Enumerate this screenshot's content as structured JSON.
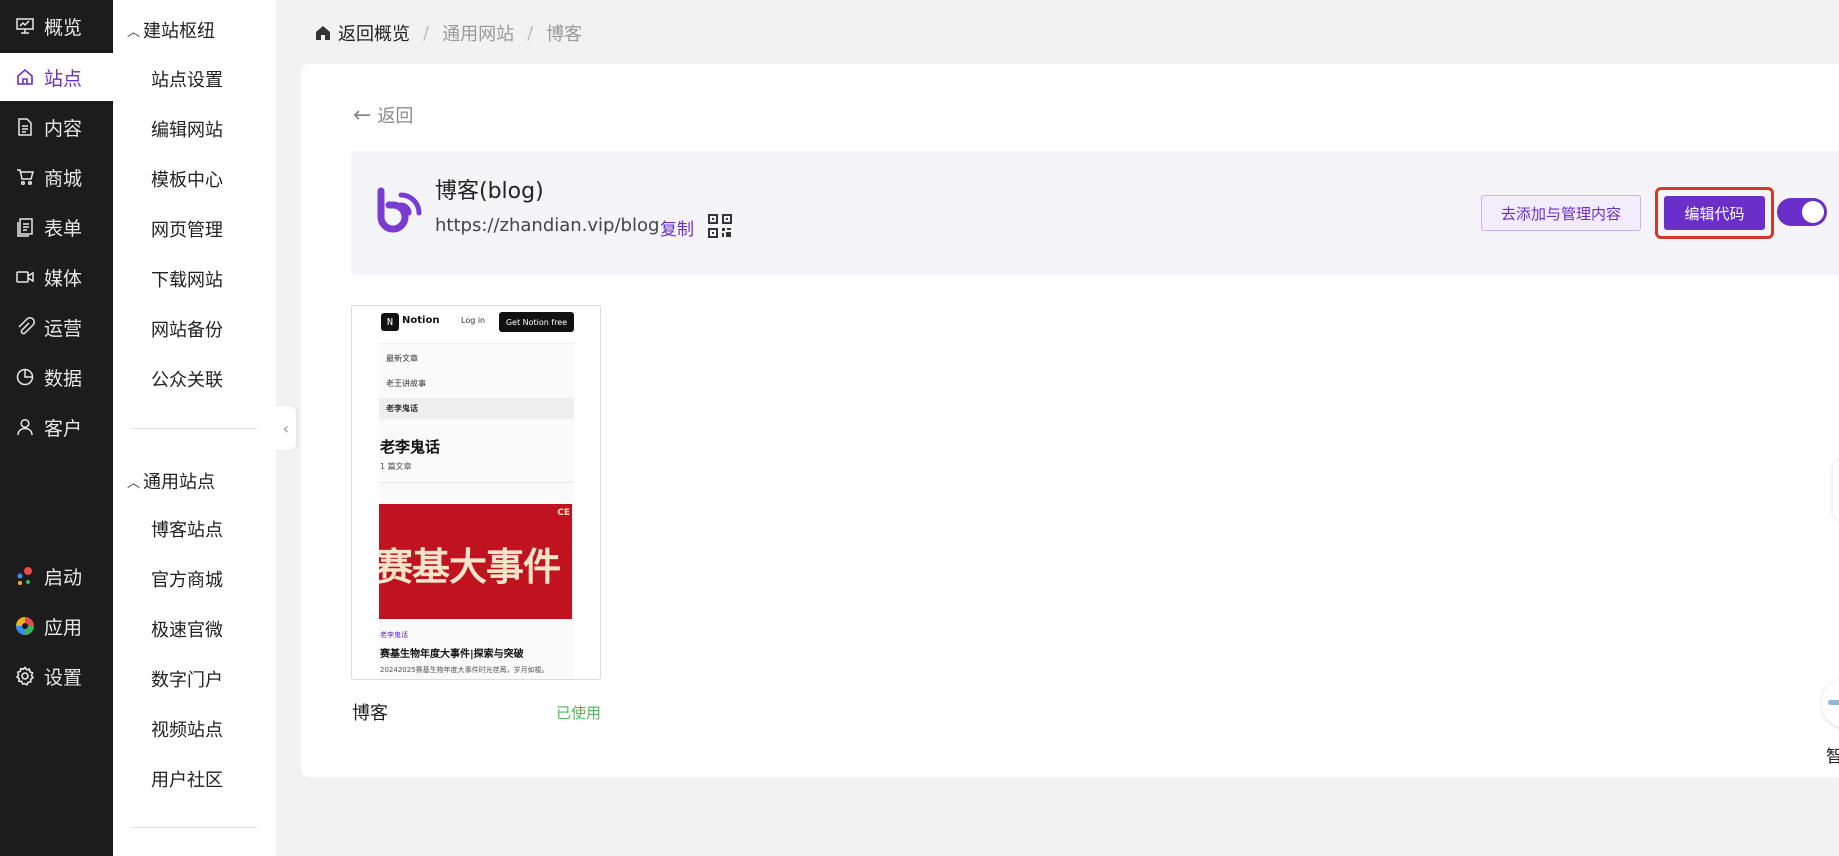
{
  "nav": {
    "items": [
      {
        "label": "概览",
        "icon": "presentation-board-icon"
      },
      {
        "label": "站点",
        "icon": "home-icon",
        "active": true
      },
      {
        "label": "内容",
        "icon": "document-icon"
      },
      {
        "label": "商城",
        "icon": "cart-icon"
      },
      {
        "label": "表单",
        "icon": "form-icon"
      },
      {
        "label": "媒体",
        "icon": "video-camera-icon"
      },
      {
        "label": "运营",
        "icon": "paperclip-icon"
      },
      {
        "label": "数据",
        "icon": "pie-chart-icon"
      },
      {
        "label": "客户",
        "icon": "user-icon"
      }
    ],
    "bottom_items": [
      {
        "label": "启动",
        "icon": "launch-dots-icon"
      },
      {
        "label": "应用",
        "icon": "apps-pinwheel-icon"
      },
      {
        "label": "设置",
        "icon": "gear-icon"
      }
    ]
  },
  "subnav": {
    "group1": {
      "title": "建站枢纽",
      "items": [
        "站点设置",
        "编辑网站",
        "模板中心",
        "网页管理",
        "下载网站",
        "网站备份",
        "公众关联"
      ]
    },
    "group2": {
      "title": "通用站点",
      "items": [
        "博客站点",
        "官方商城",
        "极速官微",
        "数字门户",
        "视频站点",
        "用户社区"
      ]
    }
  },
  "breadcrumb": {
    "back": "返回概览",
    "level1": "通用网站",
    "level2": "博客",
    "separator": "/"
  },
  "main": {
    "back_label": "返回",
    "site": {
      "name": "博客(blog)",
      "url": "https://zhandian.vip/blog",
      "copy_label": "复制",
      "manage_button": "去添加与管理内容",
      "edit_code_button": "编辑代码",
      "enabled": true
    },
    "template": {
      "preview": {
        "logo_letter": "N",
        "brand": "Notion",
        "login": "Log in",
        "cta": "Get Notion free",
        "menu": [
          "最新文章",
          "老王讲故事",
          "老李鬼话"
        ],
        "selected_menu": "老李鬼话",
        "title": "老李鬼话",
        "count": "1 篇文章",
        "banner_text": "赛基大事件",
        "banner_mark": "CE",
        "category": "老李鬼话",
        "post_title": "赛基生物年度大事件|探索与突破",
        "excerpt": "20242025赛基生物年度大事件时光荏苒，岁月如梭。"
      },
      "name": "博客",
      "status": "已使用"
    }
  },
  "floating": {
    "label": "智"
  },
  "colors": {
    "accent": "#6a2fc8",
    "nav_bg": "#1c1c1c",
    "highlight_border": "#d23a2a",
    "used_status": "#4cb85c"
  }
}
